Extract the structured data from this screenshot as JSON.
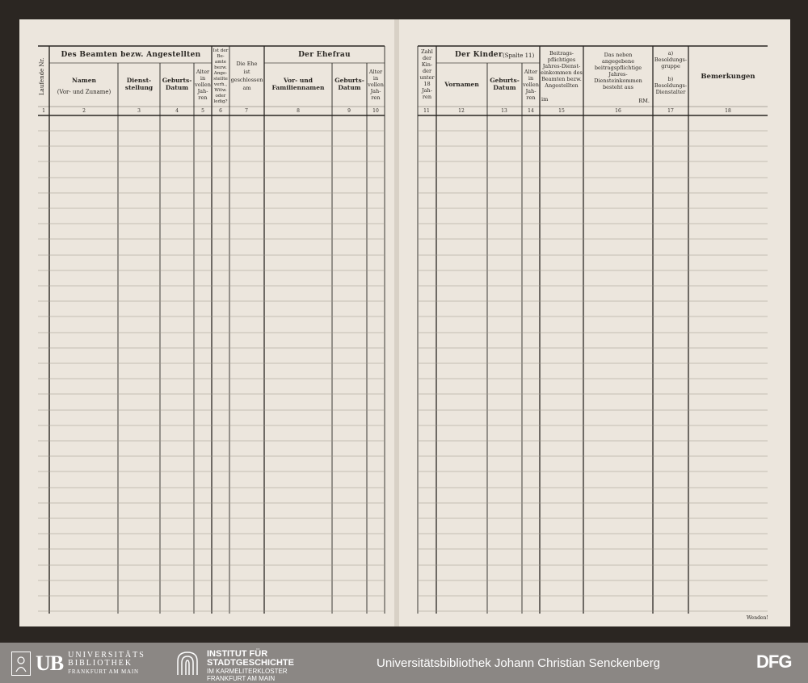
{
  "left_page": {
    "headers": {
      "lfd_nr": "Laufende Nr.",
      "beamten_group": "Des Beamten bezw. Angestellten",
      "namen": "Namen",
      "namen_sub": "(Vor- und Zuname)",
      "dienststellung": "Dienst-\nstellung",
      "geburtsdatum": "Geburts-\nDatum",
      "alter": "Alter\nin\nvollen\nJah-\nren",
      "beamte_status": "Ist der\nBe-\namte\nbezw.\nAnge-\nstellte\nverh.,\nWitw.\noder\nledig?",
      "ehe": "Die Ehe\nist\ngeschlossen\nam",
      "ehefrau_group": "Der Ehefrau",
      "ehefrau_name": "Vor- und\nFamiliennamen",
      "ehefrau_geb": "Geburts-\nDatum",
      "ehefrau_alter": "Alter\nin\nvollen\nJah-\nren"
    },
    "column_numbers": [
      "1",
      "2",
      "3",
      "4",
      "5",
      "6",
      "7",
      "8",
      "9",
      "10"
    ]
  },
  "right_page": {
    "headers": {
      "zahl_kinder": "Zahl\nder\nKin-\nder\nunter\n18\nJah-\nren",
      "kinder_group": "Der Kinder",
      "kinder_note": "(Spalte 11)",
      "vornamen": "Vornamen",
      "geburtsdatum": "Geburts-\nDatum",
      "alter": "Alter\nin\nvollen\nJah-\nren",
      "beitrag": "Beitrags-\npflichtiges\nJahres-Dienst-\neinkommen des\nBeamten bezw.\nAngestellten",
      "beitrag_unit": "im",
      "neben": "Das neben\nangegebene\nbeitragspflichtige\nJahres-\nDiensteinkommen\nbesteht aus",
      "neben_unit": "RM.",
      "besoldung": "a)\nBesoldungs-\ngruppe\n\nb)\nBesoldungs-\nDienstalter",
      "bemerkungen": "Bemerkungen"
    },
    "column_numbers": [
      "11",
      "12",
      "13",
      "14",
      "15",
      "16",
      "17",
      "18"
    ],
    "footer_note": "Wenden!"
  },
  "footer": {
    "ub_badge": "UB",
    "ub_line1": "UNIVERSITÄTS",
    "ub_line2": "BIBLIOTHEK",
    "ub_line3": "FRANKFURT AM MAIN",
    "isg_line1": "INSTITUT FÜR",
    "isg_line2": "STADTGESCHICHTE",
    "isg_line3": "IM KARMELITERKLOSTER",
    "isg_line4": "FRANKFURT AM MAIN",
    "center_text": "Universitätsbibliothek Johann Christian Senckenberg",
    "dfg": "DFG"
  },
  "colors": {
    "background": "#2b2622",
    "paper": "#ece6dd",
    "ink": "#2a2723",
    "footer": "#8b8784"
  }
}
